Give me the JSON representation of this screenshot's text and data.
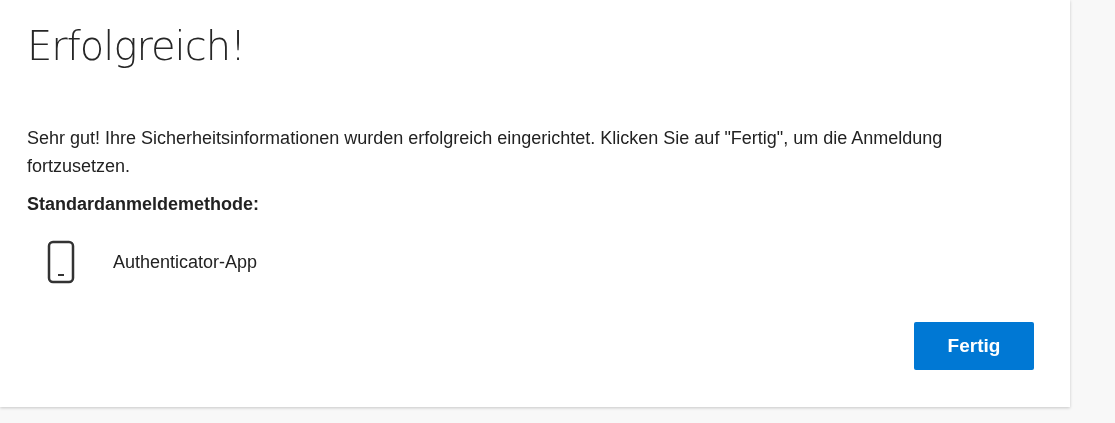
{
  "title": "Erfolgreich!",
  "message": "Sehr gut! Ihre Sicherheitsinformationen wurden erfolgreich eingerichtet. Klicken Sie auf \"Fertig\", um die Anmeldung fortzusetzen.",
  "default_method": {
    "label": "Standardanmeldemethode:",
    "method": "Authenticator-App"
  },
  "buttons": [
    "Fertig"
  ]
}
